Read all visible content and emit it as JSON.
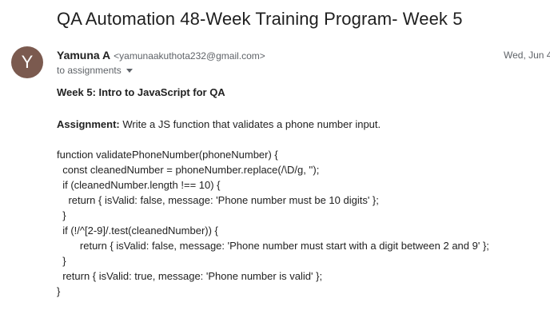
{
  "email": {
    "subject": "QA Automation 48-Week Training Program- Week 5",
    "avatar_letter": "Y",
    "sender_name": "Yamuna A",
    "sender_email": "<yamunaakuthota232@gmail.com>",
    "date": "Wed, Jun 4",
    "recipient": "to assignments",
    "body": {
      "week_heading": "Week 5: Intro to JavaScript for QA",
      "assignment_label": "Assignment:",
      "assignment_text": " Write a JS function that validates a phone number input.",
      "code_lines": [
        "function validatePhoneNumber(phoneNumber) {",
        "  const cleanedNumber = phoneNumber.replace(/\\D/g, '');",
        "  if (cleanedNumber.length !== 10) {",
        "    return { isValid: false, message: 'Phone number must be 10 digits' };",
        "  }",
        "  if (!/^[2-9]/.test(cleanedNumber)) {",
        "        return { isValid: false, message: 'Phone number must start with a digit between 2 and 9' };",
        "  }",
        "  return { isValid: true, message: 'Phone number is valid' };",
        "}"
      ]
    }
  }
}
